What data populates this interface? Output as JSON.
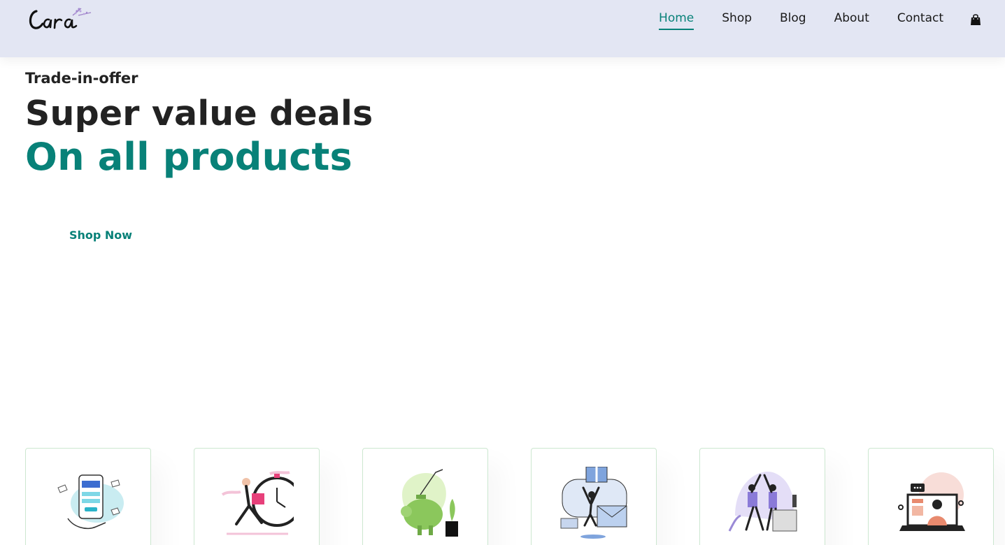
{
  "brand": {
    "name": "Cara"
  },
  "nav": {
    "items": [
      {
        "label": "Home",
        "active": true
      },
      {
        "label": "Shop",
        "active": false
      },
      {
        "label": "Blog",
        "active": false
      },
      {
        "label": "About",
        "active": false
      },
      {
        "label": "Contact",
        "active": false
      }
    ],
    "cart_icon": "shopping-bag-icon"
  },
  "hero": {
    "kicker": "Trade-in-offer",
    "title_line1": "Super value deals",
    "title_line2": "On all products",
    "button_label": "Shop Now"
  },
  "features": [
    {
      "icon": "mobile-payment-illustration"
    },
    {
      "icon": "fast-delivery-illustration"
    },
    {
      "icon": "piggy-bank-savings-illustration"
    },
    {
      "icon": "gift-envelope-illustration"
    },
    {
      "icon": "high-five-team-illustration"
    },
    {
      "icon": "online-support-laptop-illustration"
    }
  ],
  "colors": {
    "header_bg": "#e3e6f3",
    "accent": "#088178",
    "text": "#1a1a1a",
    "card_border": "#cce7d0"
  }
}
